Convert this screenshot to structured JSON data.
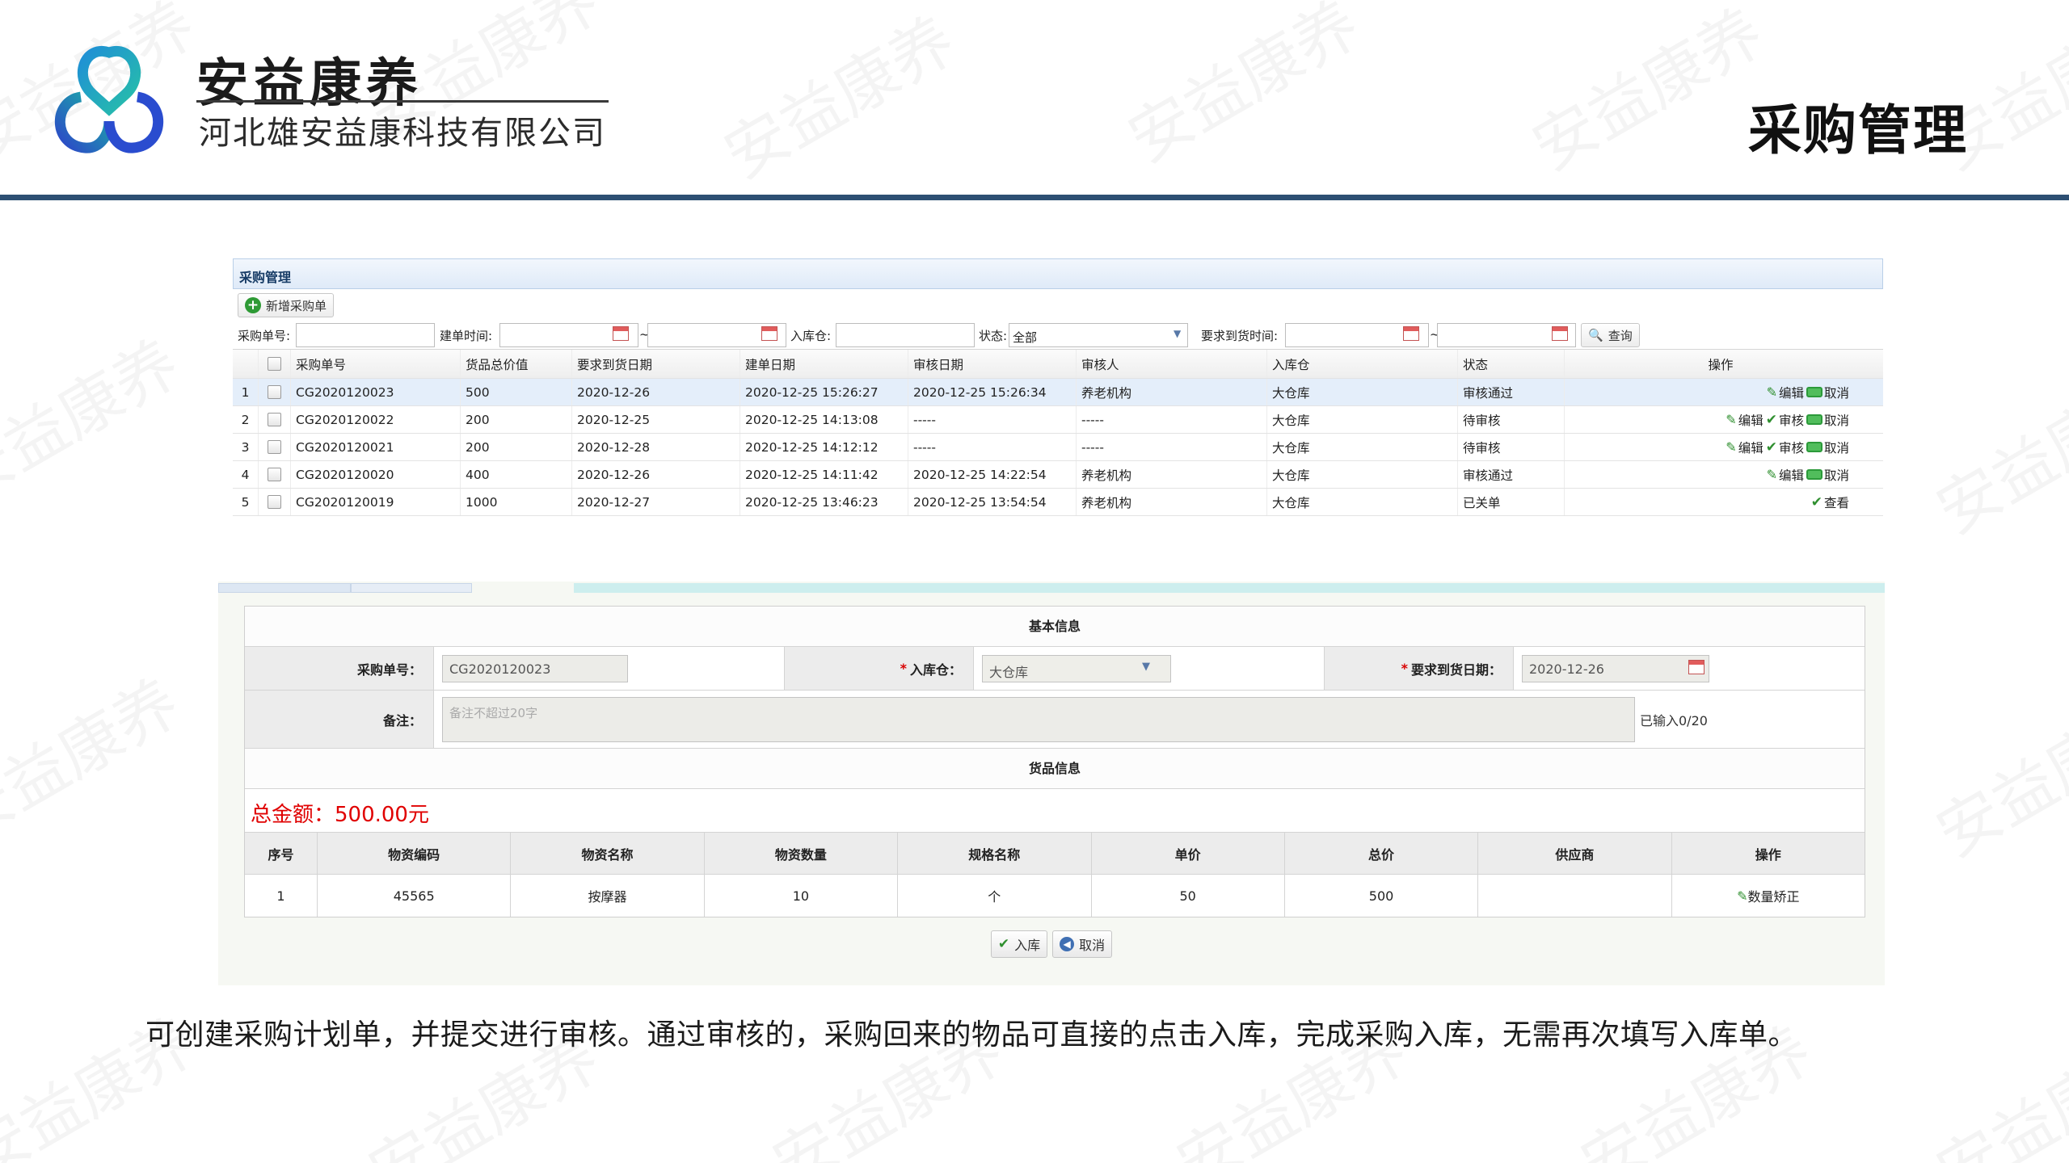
{
  "brand": {
    "name": "安益康养",
    "company": "河北雄安益康科技有限公司",
    "watermark": "安益康养"
  },
  "page_title": "采购管理",
  "list_panel": {
    "title": "采购管理",
    "new_button": "新增采购单",
    "filters": {
      "order_no_label": "采购单号:",
      "create_time_label": "建单时间:",
      "range_sep": "~",
      "warehouse_label": "入库仓:",
      "status_label": "状态:",
      "status_value": "全部",
      "arrival_label": "要求到货时间:",
      "search_button": "查询"
    },
    "columns": [
      "采购单号",
      "货品总价值",
      "要求到货日期",
      "建单日期",
      "审核日期",
      "审核人",
      "入库仓",
      "状态",
      "操作"
    ],
    "rows": [
      {
        "idx": "1",
        "order_no": "CG2020120023",
        "total": "500",
        "due": "2020-12-26",
        "created": "2020-12-25 15:26:27",
        "audited": "2020-12-25 15:26:34",
        "auditor": "养老机构",
        "warehouse": "大仓库",
        "status": "审核通过",
        "ops": [
          "编辑",
          "取消"
        ]
      },
      {
        "idx": "2",
        "order_no": "CG2020120022",
        "total": "200",
        "due": "2020-12-25",
        "created": "2020-12-25 14:13:08",
        "audited": "-----",
        "auditor": "-----",
        "warehouse": "大仓库",
        "status": "待审核",
        "ops": [
          "编辑",
          "审核",
          "取消"
        ]
      },
      {
        "idx": "3",
        "order_no": "CG2020120021",
        "total": "200",
        "due": "2020-12-28",
        "created": "2020-12-25 14:12:12",
        "audited": "-----",
        "auditor": "-----",
        "warehouse": "大仓库",
        "status": "待审核",
        "ops": [
          "编辑",
          "审核",
          "取消"
        ]
      },
      {
        "idx": "4",
        "order_no": "CG2020120020",
        "total": "400",
        "due": "2020-12-26",
        "created": "2020-12-25 14:11:42",
        "audited": "2020-12-25 14:22:54",
        "auditor": "养老机构",
        "warehouse": "大仓库",
        "status": "审核通过",
        "ops": [
          "编辑",
          "取消"
        ]
      },
      {
        "idx": "5",
        "order_no": "CG2020120019",
        "total": "1000",
        "due": "2020-12-27",
        "created": "2020-12-25 13:46:23",
        "audited": "2020-12-25 13:54:54",
        "auditor": "养老机构",
        "warehouse": "大仓库",
        "status": "已关单",
        "ops": [
          "查看"
        ]
      }
    ]
  },
  "detail_panel": {
    "basic_info_title": "基本信息",
    "order_no_label": "采购单号：",
    "order_no_value": "CG2020120023",
    "warehouse_label": "入库仓：",
    "warehouse_value": "大仓库",
    "due_label": "要求到货日期：",
    "due_value": "2020-12-26",
    "remark_label": "备注：",
    "remark_placeholder": "备注不超过20字",
    "remark_counter": "已输入0/20",
    "goods_info_title": "货品信息",
    "total_amount": "总金额：500.00元",
    "goods_columns": [
      "序号",
      "物资编码",
      "物资名称",
      "物资数量",
      "规格名称",
      "单价",
      "总价",
      "供应商",
      "操作"
    ],
    "goods_rows": [
      {
        "idx": "1",
        "code": "45565",
        "name": "按摩器",
        "qty": "10",
        "spec": "个",
        "unit_price": "50",
        "total": "500",
        "supplier": "",
        "op": "数量矫正"
      }
    ],
    "stock_in_button": "入库",
    "cancel_button": "取消"
  },
  "caption": "可创建采购计划单，并提交进行审核。通过审核的，采购回来的物品可直接的点击入库，完成采购入库，无需再次填写入库单。",
  "colors": {
    "header_bar": "#2d4f73",
    "total_red": "#e00000",
    "accent_green": "#2f8f2f"
  }
}
